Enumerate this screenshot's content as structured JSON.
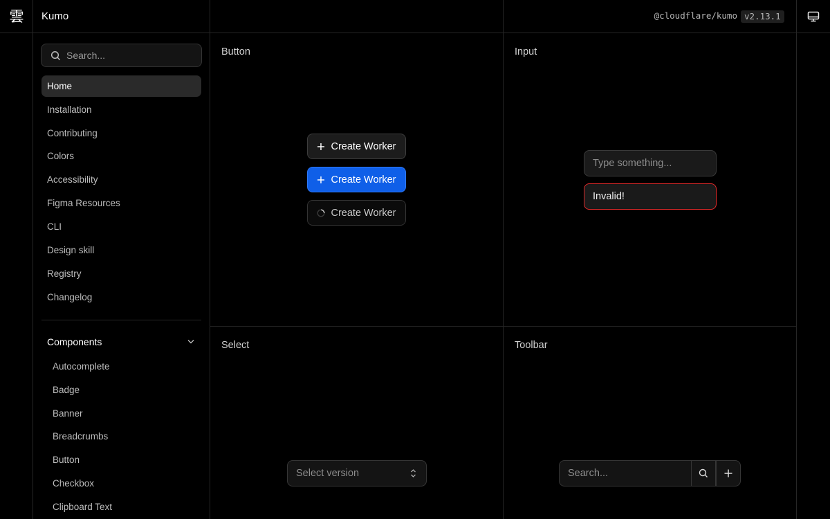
{
  "app": {
    "logo_glyph": "雲",
    "logo_icon": "cloud-kanji-icon",
    "name": "Kumo"
  },
  "header": {
    "package": "@cloudflare/kumo",
    "version": "v2.13.1",
    "theme_icon": "monitor-icon"
  },
  "sidebar": {
    "search_placeholder": "Search...",
    "items": [
      {
        "label": "Home",
        "active": true
      },
      {
        "label": "Installation"
      },
      {
        "label": "Contributing"
      },
      {
        "label": "Colors"
      },
      {
        "label": "Accessibility"
      },
      {
        "label": "Figma Resources"
      },
      {
        "label": "CLI"
      },
      {
        "label": "Design skill"
      },
      {
        "label": "Registry"
      },
      {
        "label": "Changelog"
      }
    ],
    "components_header": "Components",
    "components": [
      "Autocomplete",
      "Badge",
      "Banner",
      "Breadcrumbs",
      "Button",
      "Checkbox",
      "Clipboard Text"
    ]
  },
  "panels": {
    "button": {
      "title": "Button",
      "secondary_label": "Create Worker",
      "primary_label": "Create Worker",
      "loading_label": "Create Worker"
    },
    "input": {
      "title": "Input",
      "placeholder": "Type something...",
      "invalid_value": "Invalid!"
    },
    "select": {
      "title": "Select",
      "placeholder": "Select version"
    },
    "toolbar": {
      "title": "Toolbar",
      "search_placeholder": "Search..."
    }
  },
  "colors": {
    "primary": "#0f5fe8",
    "error": "#e02a2a",
    "background": "#000000",
    "border": "#262626"
  }
}
